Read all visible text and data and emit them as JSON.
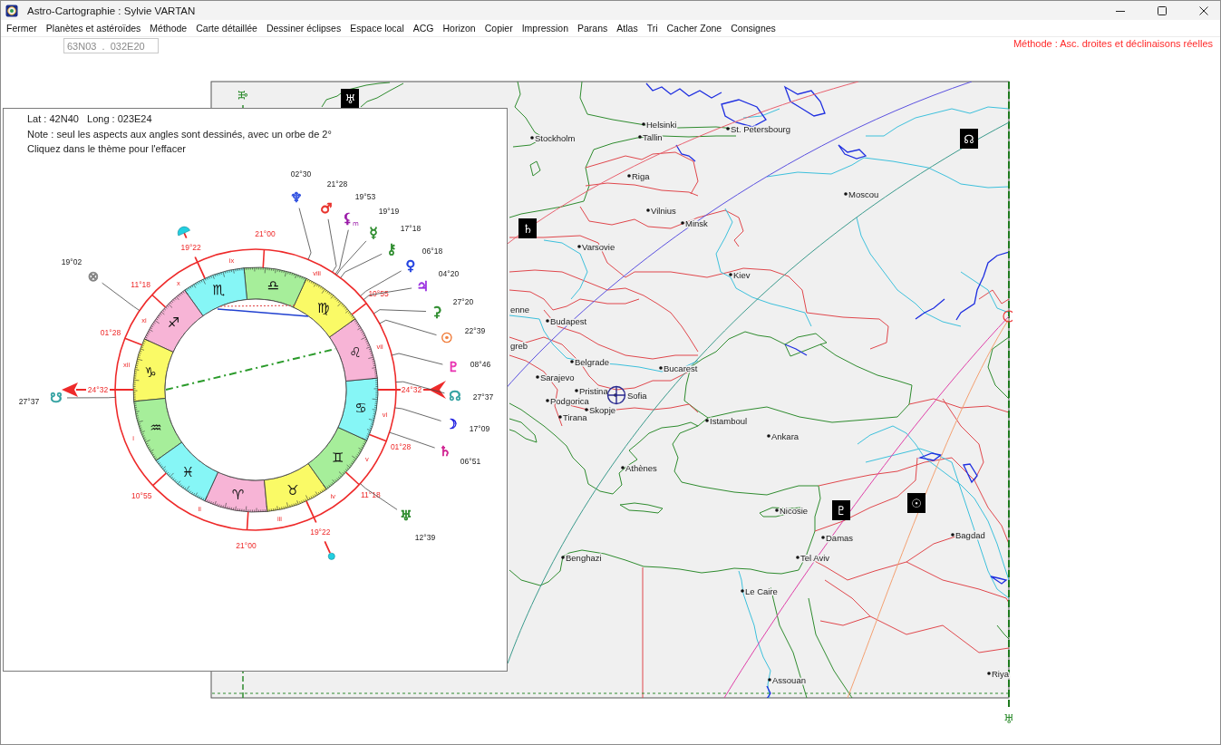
{
  "window": {
    "title": "Astro-Cartographie : Sylvie VARTAN"
  },
  "menu": [
    "Fermer",
    "Planètes et astéroïdes",
    "Méthode",
    "Carte détaillée",
    "Dessiner éclipses",
    "Espace local",
    "ACG",
    "Horizon",
    "Copier",
    "Impression",
    "Parans",
    "Atlas",
    "Tri",
    "Cacher Zone",
    "Consignes"
  ],
  "toolbar": {
    "coordinates": "63N03  .  032E20",
    "method": "Méthode : Asc. droites et déclinaisons réelles"
  },
  "map": {
    "lines": [
      {
        "color": "#e8606e"
      },
      {
        "color": "#5a50e0"
      },
      {
        "color": "#3a9a8c"
      },
      {
        "color": "#e040a8"
      },
      {
        "color": "#f4a070"
      }
    ],
    "cities": [
      "Stockholm",
      "Helsinki",
      "Tallin",
      "St. Petersbourg",
      "Riga",
      "Vilnius",
      "Minsk",
      "Moscou",
      "Varsovie",
      "Kiev",
      "enne",
      "Budapest",
      "greb",
      "Belgrade",
      "Bucarest",
      "Sarajevo",
      "Pristina",
      "Sofia",
      "Podgorica",
      "Skopje",
      "Tirana",
      "Istamboul",
      "Ankara",
      "Athènes",
      "Nicosie",
      "Damas",
      "Bagdad",
      "Benghazi",
      "Tel Aviv",
      "Le Caire",
      "Riya",
      "Assouan"
    ],
    "markers": [
      {
        "kind": "plain",
        "glyph": "♅"
      },
      {
        "kind": "boxed",
        "glyph": "♅"
      },
      {
        "kind": "boxed",
        "glyph": "☊"
      },
      {
        "kind": "boxed",
        "glyph": "♄"
      },
      {
        "kind": "boxed",
        "glyph": "♇"
      },
      {
        "kind": "boxed",
        "glyph": "☉"
      },
      {
        "kind": "plain",
        "glyph": "♅"
      }
    ]
  },
  "chart_panel": {
    "info": [
      "Lat : 42N40   Long : 023E24",
      "Note : seul les aspects aux angles sont dessinés, avec un orbe de 2°",
      "Cliquez dans le thème pour l'effacer"
    ],
    "signs": [
      {
        "glyph": "♈",
        "color": "#f7b4d6"
      },
      {
        "glyph": "♉",
        "color": "#fafa66"
      },
      {
        "glyph": "♊",
        "color": "#a6ee9a"
      },
      {
        "glyph": "♋",
        "color": "#86f6f6"
      },
      {
        "glyph": "♌",
        "color": "#f7b4d6"
      },
      {
        "glyph": "♍",
        "color": "#fafa66"
      },
      {
        "glyph": "♎",
        "color": "#a6ee9a"
      },
      {
        "glyph": "♏",
        "color": "#86f6f6"
      },
      {
        "glyph": "♐",
        "color": "#f7b4d6"
      },
      {
        "glyph": "♑",
        "color": "#fafa66"
      },
      {
        "glyph": "♒",
        "color": "#a6ee9a"
      },
      {
        "glyph": "♓",
        "color": "#86f6f6"
      }
    ],
    "cusps": [
      {
        "kind": "mc",
        "degree": "19°22"
      },
      {
        "kind": "cusp",
        "degree": "21°00"
      },
      {
        "kind": "cusp",
        "degree": "11°18"
      },
      {
        "kind": "cusp",
        "degree": "10°55"
      },
      {
        "kind": "cusp",
        "degree": "01°28"
      },
      {
        "kind": "asc",
        "degree": "24°32"
      },
      {
        "kind": "desc",
        "degree": "24°32"
      },
      {
        "kind": "cusp",
        "degree": "01°28"
      },
      {
        "kind": "cusp",
        "degree": "10°55"
      },
      {
        "kind": "cusp",
        "degree": "11°18"
      },
      {
        "kind": "cusp",
        "degree": "21°00"
      },
      {
        "kind": "ic",
        "degree": "19°22"
      }
    ],
    "house_numbers": [
      "ix",
      "viii",
      "x",
      "xi",
      "vii",
      "xii",
      "vi",
      "i",
      "v",
      "iv",
      "ii",
      "iii"
    ],
    "bodies": [
      {
        "glyph": "♆",
        "degree": "02°30",
        "color": "#3050e0"
      },
      {
        "glyph": "♂",
        "degree": "21°28",
        "color": "#e8302a"
      },
      {
        "glyph": "⚸$_{m}$",
        "degree": "19°53",
        "color": "#9a1aa8"
      },
      {
        "glyph": "☿",
        "degree": "19°19",
        "color": "#2a8a2a"
      },
      {
        "glyph": "⚷",
        "degree": "17°18",
        "color": "#2a8a2a"
      },
      {
        "glyph": "♀",
        "degree": "06°18",
        "color": "#2040e0"
      },
      {
        "glyph": "♃",
        "degree": "04°20",
        "color": "#9a30e0"
      },
      {
        "glyph": "⚳",
        "degree": "27°20",
        "color": "#2a8a2a"
      },
      {
        "glyph": "☉",
        "degree": "22°39",
        "color": "#f08040"
      },
      {
        "glyph": "♇",
        "degree": "08°46",
        "color": "#e830b0"
      },
      {
        "glyph": "☊",
        "degree": "27°37",
        "color": "#30a0a0"
      },
      {
        "glyph": "☽",
        "degree": "17°09",
        "color": "#2020e0"
      },
      {
        "glyph": "♄",
        "degree": "06°51",
        "color": "#d02090"
      },
      {
        "glyph": "♅",
        "degree": "12°39",
        "color": "#2a8a2a"
      },
      {
        "glyph": "☋",
        "degree": "27°37",
        "color": "#30a0a0"
      },
      {
        "glyph": "⊗",
        "degree": "19°02",
        "color": "#808080"
      }
    ]
  }
}
